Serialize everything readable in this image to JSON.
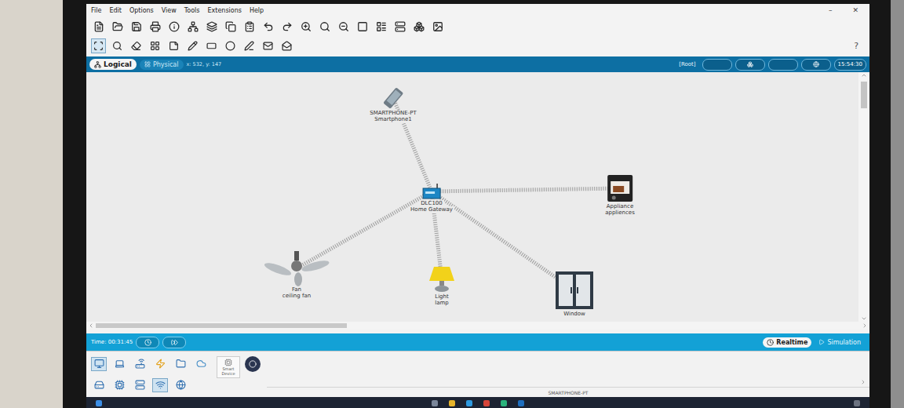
{
  "window": {
    "controls": [
      "–",
      "✕"
    ]
  },
  "menu": [
    "File",
    "Edit",
    "Options",
    "View",
    "Tools",
    "Extensions",
    "Help"
  ],
  "help_button": "?",
  "workspace_tabs": [
    {
      "label": "Logical",
      "selected": true
    },
    {
      "label": "Physical",
      "selected": false
    }
  ],
  "cursor_position": "x: 532, y: 147",
  "root_label": "[Root]",
  "clock": "15:54:30",
  "nodes": [
    {
      "kind": "smartphone",
      "model": "SMARTPHONE-PT",
      "name": "Smartphone1"
    },
    {
      "kind": "gateway",
      "model": "DLC100",
      "name": "Home Gateway"
    },
    {
      "kind": "appliance",
      "model": "Appliance",
      "name": "appliences"
    },
    {
      "kind": "fan",
      "model": "Fan",
      "name": "ceiling fan"
    },
    {
      "kind": "light",
      "model": "Light",
      "name": "lamp"
    },
    {
      "kind": "window",
      "model": "Window",
      "name": ""
    }
  ],
  "links": [
    {
      "from": "DLC100",
      "to": "SMARTPHONE-PT",
      "kind": "wireless"
    },
    {
      "from": "DLC100",
      "to": "Appliance",
      "kind": "wireless"
    },
    {
      "from": "DLC100",
      "to": "Fan",
      "kind": "wireless"
    },
    {
      "from": "DLC100",
      "to": "Light",
      "kind": "wireless"
    },
    {
      "from": "DLC100",
      "to": "Window",
      "kind": "wireless"
    }
  ],
  "time_bar": {
    "time": "Time: 00:31:45"
  },
  "modes": [
    {
      "label": "Realtime",
      "selected": true
    },
    {
      "label": "Simulation",
      "selected": false
    }
  ],
  "palette": {
    "smart_device_label": "Smart Device",
    "selected_device": "SMARTPHONE-PT"
  }
}
